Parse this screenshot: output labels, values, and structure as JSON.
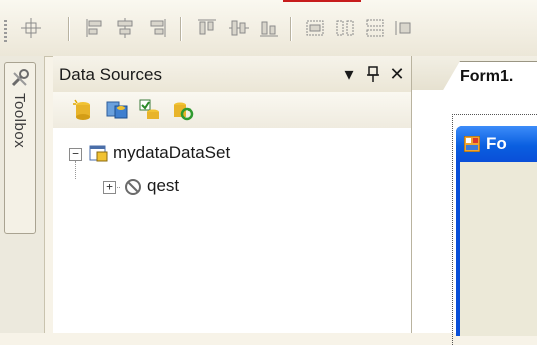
{
  "toolbar": {
    "icons": [
      "align-lefts-icon",
      "align-centers-icon",
      "align-rights-icon",
      "align-tops-icon",
      "align-middles-icon",
      "align-bottoms-icon",
      "make-same-size-icon",
      "horizontal-spacing-icon",
      "vertical-spacing-icon"
    ]
  },
  "toolbox": {
    "label": "Toolbox"
  },
  "data_sources": {
    "title": "Data Sources",
    "dropdown_glyph": "▾",
    "pin_glyph": "⊥",
    "close_glyph": "✕",
    "tools": [
      "add-new-data-source-icon",
      "edit-dataset-with-designer-icon",
      "configure-dataset-icon",
      "refresh-icon"
    ],
    "tree": {
      "root": {
        "label": "mydataDataSet",
        "expander": "−"
      },
      "child": {
        "label": "qest",
        "expander": "+"
      }
    }
  },
  "designer": {
    "tab_label": "Form1.",
    "form_title": "Fo"
  },
  "colors": {
    "accent_red": "#c71c1c",
    "form_titlebar": "#0a5fe0"
  }
}
